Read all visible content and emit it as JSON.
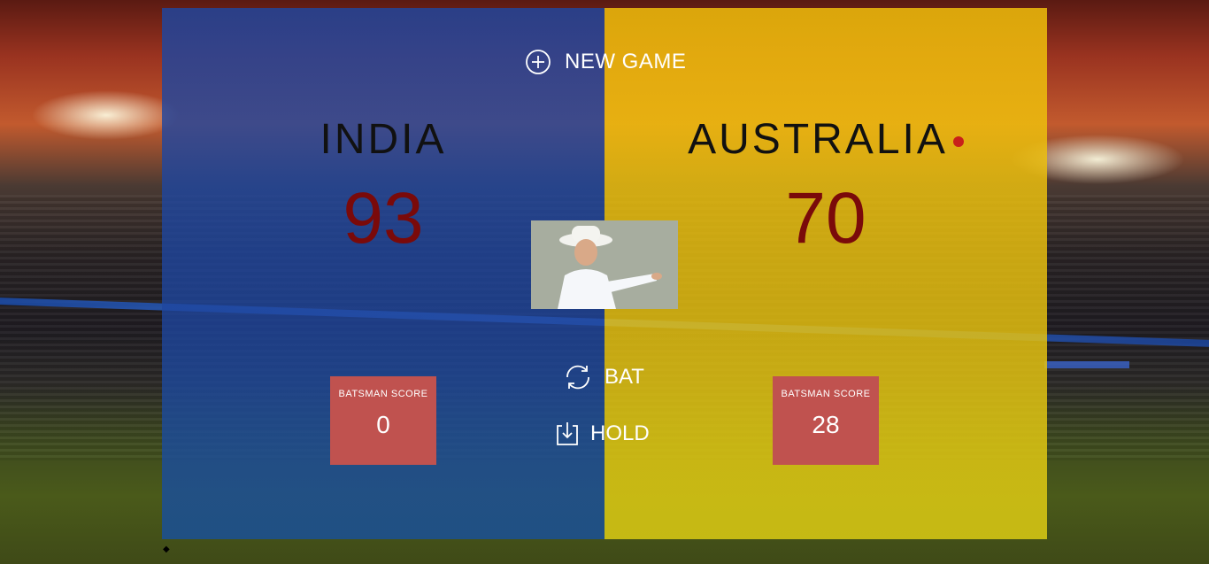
{
  "header": {
    "new_game_label": "NEW GAME",
    "new_game_icon": "circle-plus-icon"
  },
  "teams": {
    "left": {
      "name": "INDIA",
      "score": "93",
      "panel_color": "#1e46a0",
      "batsman_label": "BATSMAN SCORE",
      "batsman_score": "0",
      "is_active": false
    },
    "right": {
      "name": "AUSTRALIA",
      "score": "70",
      "panel_color": "#f0be0a",
      "batsman_label": "BATSMAN SCORE",
      "batsman_score": "28",
      "is_active": true
    }
  },
  "controls": {
    "bat_label": "BAT",
    "bat_icon": "refresh-icon",
    "hold_label": "HOLD",
    "hold_icon": "download-tray-icon"
  },
  "colors": {
    "score_text": "#7a0a0a",
    "batsman_box": "#c0524f",
    "active_indicator": "#c8201a"
  },
  "footer": {
    "bullet": "◆"
  }
}
